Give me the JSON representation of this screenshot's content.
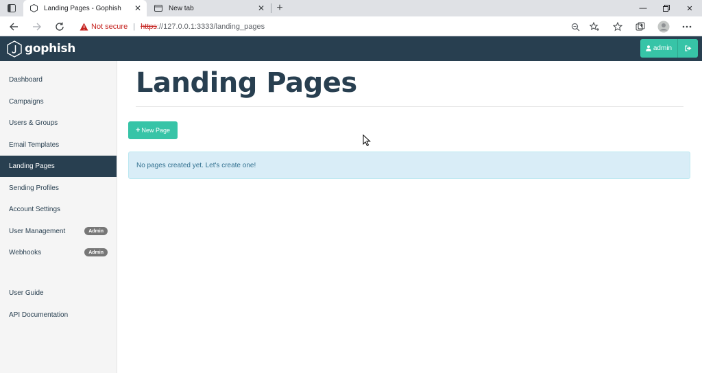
{
  "browser": {
    "tabs": [
      {
        "title": "Landing Pages - Gophish",
        "active": true
      },
      {
        "title": "New tab",
        "active": false
      }
    ],
    "address": {
      "security_label": "Not secure",
      "protocol": "https",
      "rest": "://127.0.0.1:3333/landing_pages"
    }
  },
  "navbar": {
    "brand": "gophish",
    "user_label": "admin"
  },
  "sidebar": {
    "items": [
      {
        "label": "Dashboard"
      },
      {
        "label": "Campaigns"
      },
      {
        "label": "Users & Groups"
      },
      {
        "label": "Email Templates"
      },
      {
        "label": "Landing Pages",
        "active": true
      },
      {
        "label": "Sending Profiles"
      },
      {
        "label": "Account Settings"
      },
      {
        "label": "User Management",
        "badge": "Admin"
      },
      {
        "label": "Webhooks",
        "badge": "Admin"
      }
    ],
    "secondary": [
      {
        "label": "User Guide"
      },
      {
        "label": "API Documentation"
      }
    ]
  },
  "main": {
    "title": "Landing Pages",
    "new_button_label": "New Page",
    "empty_message": "No pages created yet. Let's create one!"
  },
  "colors": {
    "navbar_bg": "#283f50",
    "accent": "#37c4a7",
    "alert_bg": "#d9edf7",
    "alert_text": "#31708f",
    "insecure_red": "#c5221f"
  }
}
